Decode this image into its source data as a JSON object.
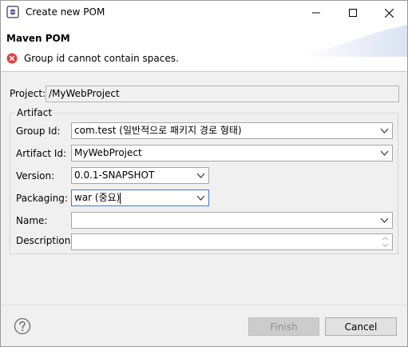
{
  "window": {
    "title": "Create new POM"
  },
  "header": {
    "page_title": "Maven POM",
    "error_message": "Group id cannot contain spaces."
  },
  "project": {
    "label": "Project:",
    "value": "/MyWebProject"
  },
  "artifact": {
    "group_label": "Artifact",
    "group_id_label": "Group Id:",
    "group_id_value": "com.test (일반적으로 패키지 경로 형태)",
    "artifact_id_label": "Artifact Id:",
    "artifact_id_value": "MyWebProject",
    "version_label": "Version:",
    "version_value": "0.0.1-SNAPSHOT",
    "packaging_label": "Packaging:",
    "packaging_value": "war (중요)",
    "name_label": "Name:",
    "name_value": "",
    "description_label": "Description:",
    "description_value": ""
  },
  "footer": {
    "finish_label": "Finish",
    "cancel_label": "Cancel"
  },
  "colors": {
    "error": "#e04343",
    "focus_border": "#3b7bd4"
  }
}
